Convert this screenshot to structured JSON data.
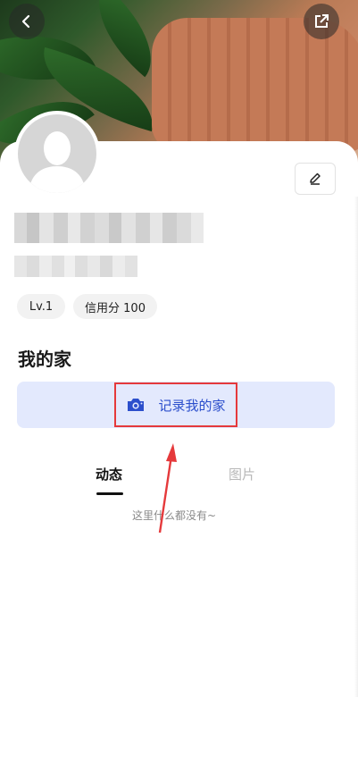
{
  "header": {
    "back_icon": "chevron-left-icon",
    "share_icon": "share-external-icon"
  },
  "profile": {
    "edit_icon": "pencil-icon",
    "badges": [
      "Lv.1",
      "信用分 100"
    ]
  },
  "home_section": {
    "title": "我的家",
    "record_button_label": "记录我的家",
    "record_icon": "camera-icon",
    "accent_color": "#2c4fcc",
    "button_bg": "#e3e9fd"
  },
  "tabs": [
    {
      "label": "动态",
      "active": true
    },
    {
      "label": "图片",
      "active": false
    }
  ],
  "empty_state": "这里什么都没有~",
  "annotation": {
    "highlight_color": "#e5393b"
  }
}
